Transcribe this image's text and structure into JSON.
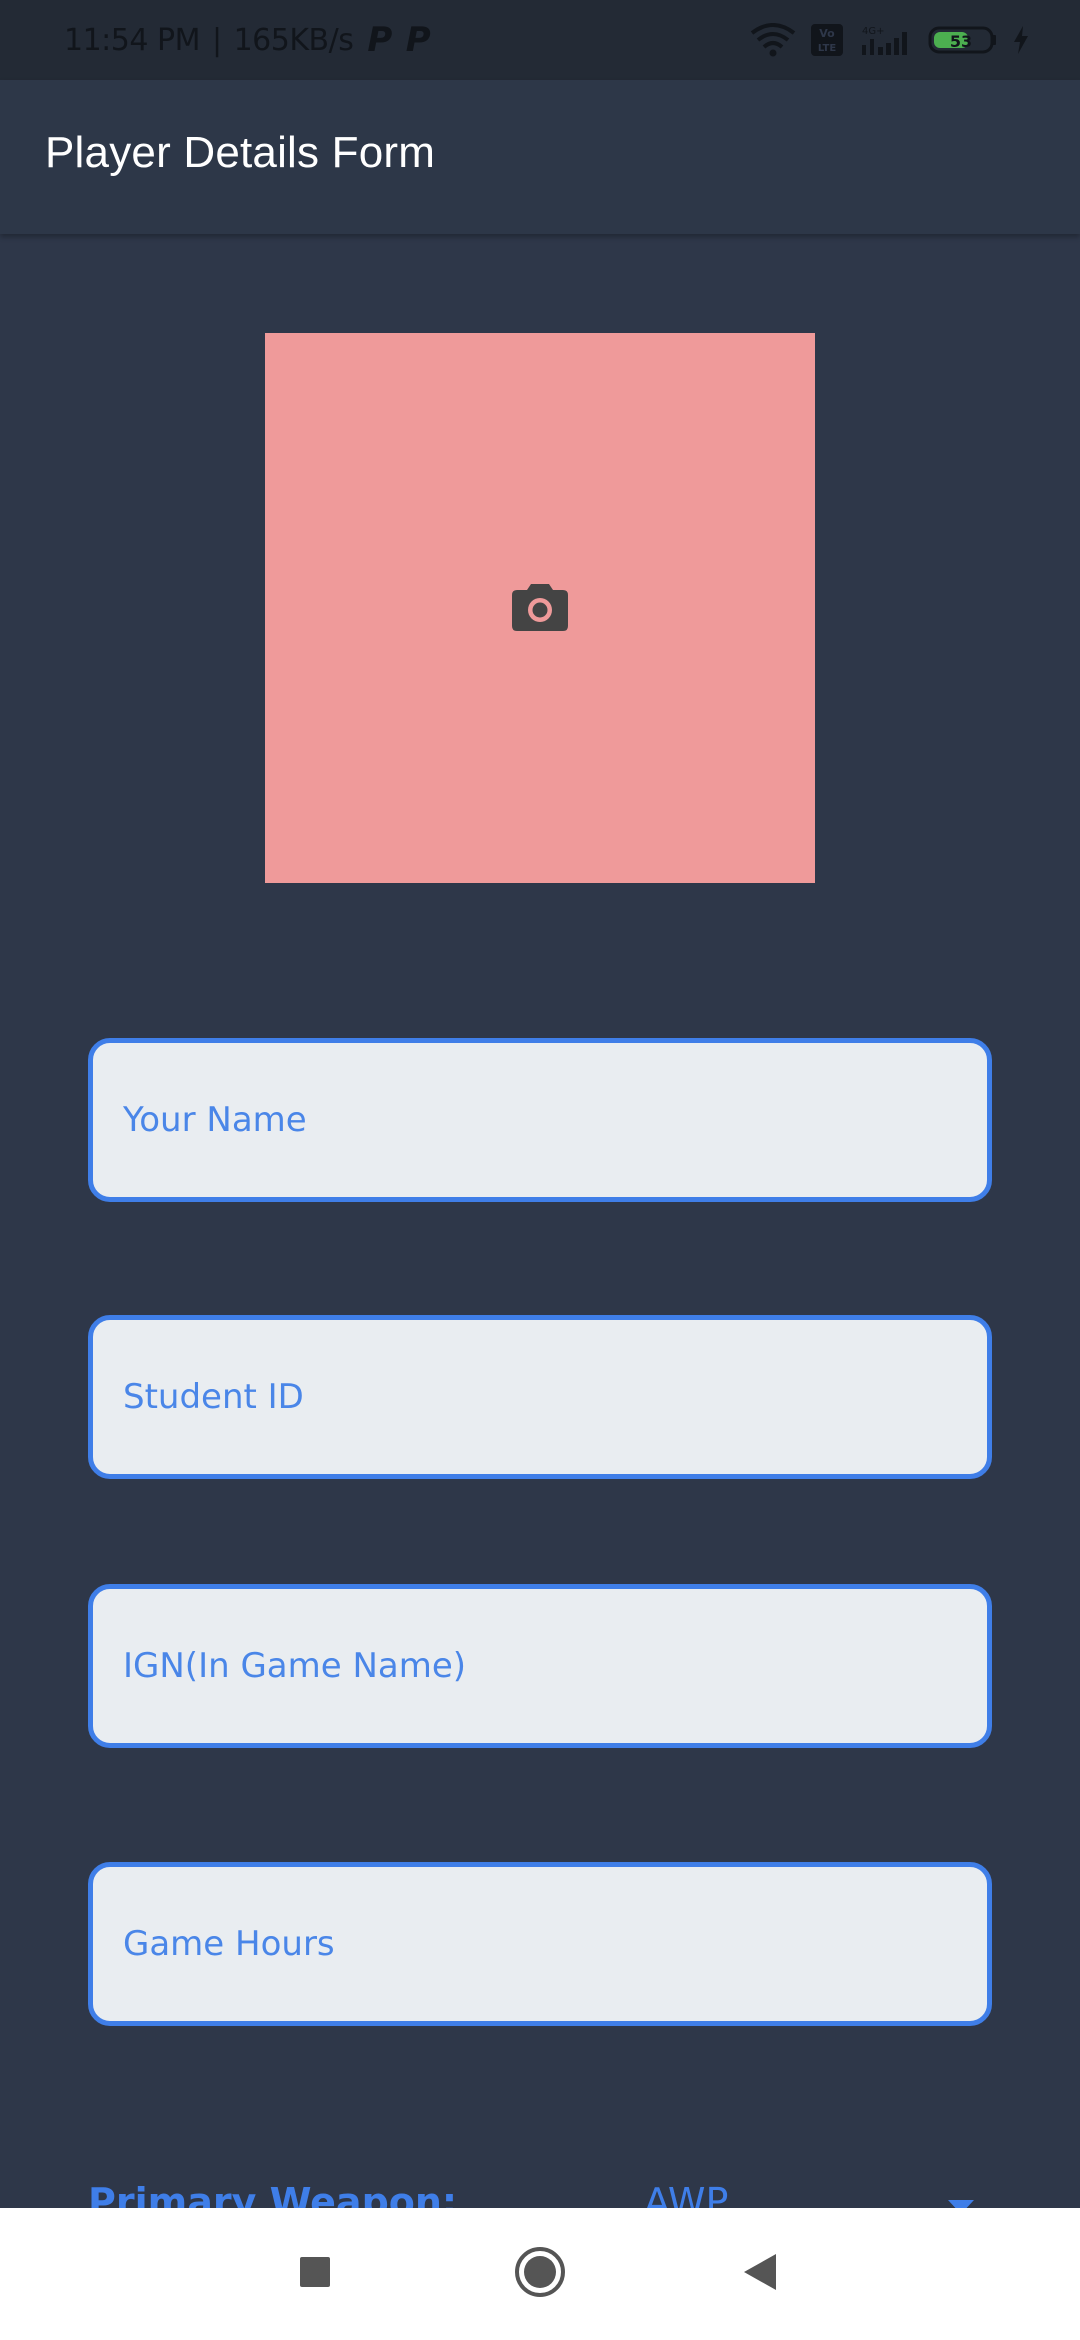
{
  "status_bar": {
    "time": "11:54 PM",
    "separator": "|",
    "net_speed": "165KB/s",
    "notification_icons": [
      "p-icon",
      "p-icon"
    ],
    "right_icons": [
      "wifi-icon",
      "volte-icon",
      "signal-icon",
      "battery-icon",
      "charging-icon"
    ],
    "battery_level": "53"
  },
  "app_bar": {
    "title": "Player Details Form"
  },
  "photo_picker": {
    "icon": "camera-icon",
    "color": "#ef9a9a"
  },
  "form": {
    "name_placeholder": "Your Name",
    "student_id_placeholder": "Student ID",
    "ign_placeholder": "IGN(In Game Name)",
    "hours_placeholder": "Game Hours",
    "weapon_label": "Primary Weapon:",
    "weapon_value": "AWP"
  },
  "colors": {
    "background": "#2e3749",
    "accent": "#3f7ee8",
    "field_fill": "#e9edf1"
  },
  "nav_bar": {
    "icons": [
      "recent-apps-icon",
      "home-icon",
      "back-icon"
    ]
  }
}
